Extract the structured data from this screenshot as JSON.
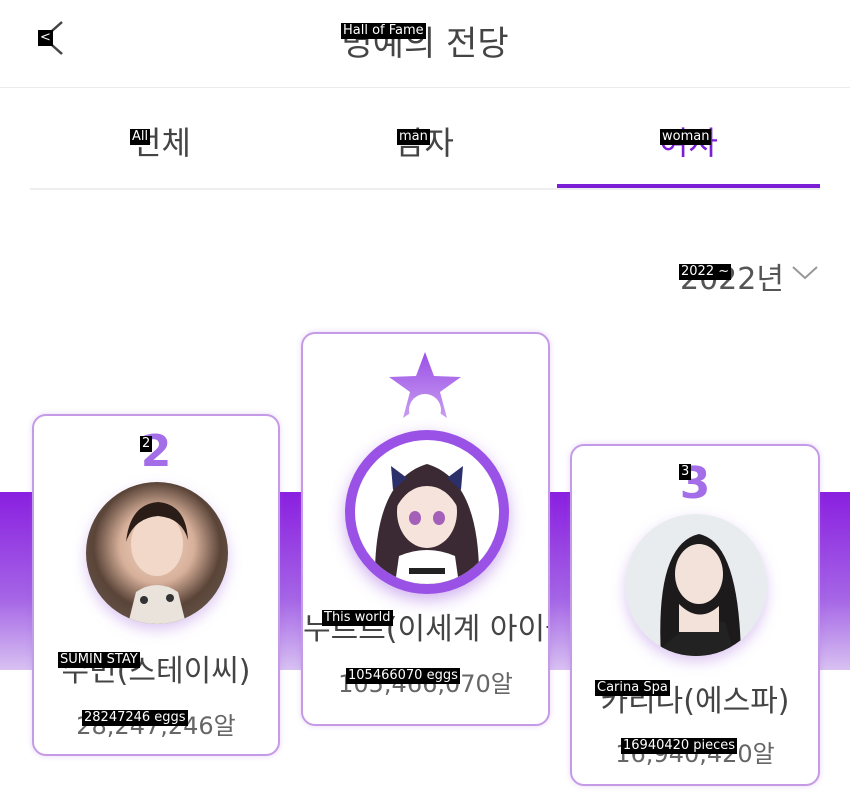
{
  "header": {
    "back_label": "<",
    "title": "Hall of Fame",
    "title_ko": "명예의 전당"
  },
  "tabs": [
    {
      "label": "All",
      "ko": "전체",
      "active": false
    },
    {
      "label": "man",
      "ko": "남자",
      "active": false
    },
    {
      "label": "woman",
      "ko": "여자",
      "active": true
    }
  ],
  "year_select": {
    "label": "2022 ~",
    "ko": "2022년"
  },
  "ranking": [
    {
      "rank": "2",
      "name": "SUMIN STAY",
      "name_ko": "수민(스테이씨)",
      "count": "28247246 eggs",
      "count_ko": "28,247,246알"
    },
    {
      "rank": "1",
      "name": "This world",
      "name_ko": "누르르(이세계 아이돌)",
      "count": "105466070 eggs",
      "count_ko": "105,466,070알"
    },
    {
      "rank": "3",
      "name": "Carina Spa",
      "name_ko": "카리나(에스파)",
      "count": "16940420 pieces",
      "count_ko": "16,940,420알"
    }
  ],
  "colors": {
    "accent": "#7a1fd6",
    "card_border": "#c59be8",
    "rank_number": "#a46ee8"
  }
}
